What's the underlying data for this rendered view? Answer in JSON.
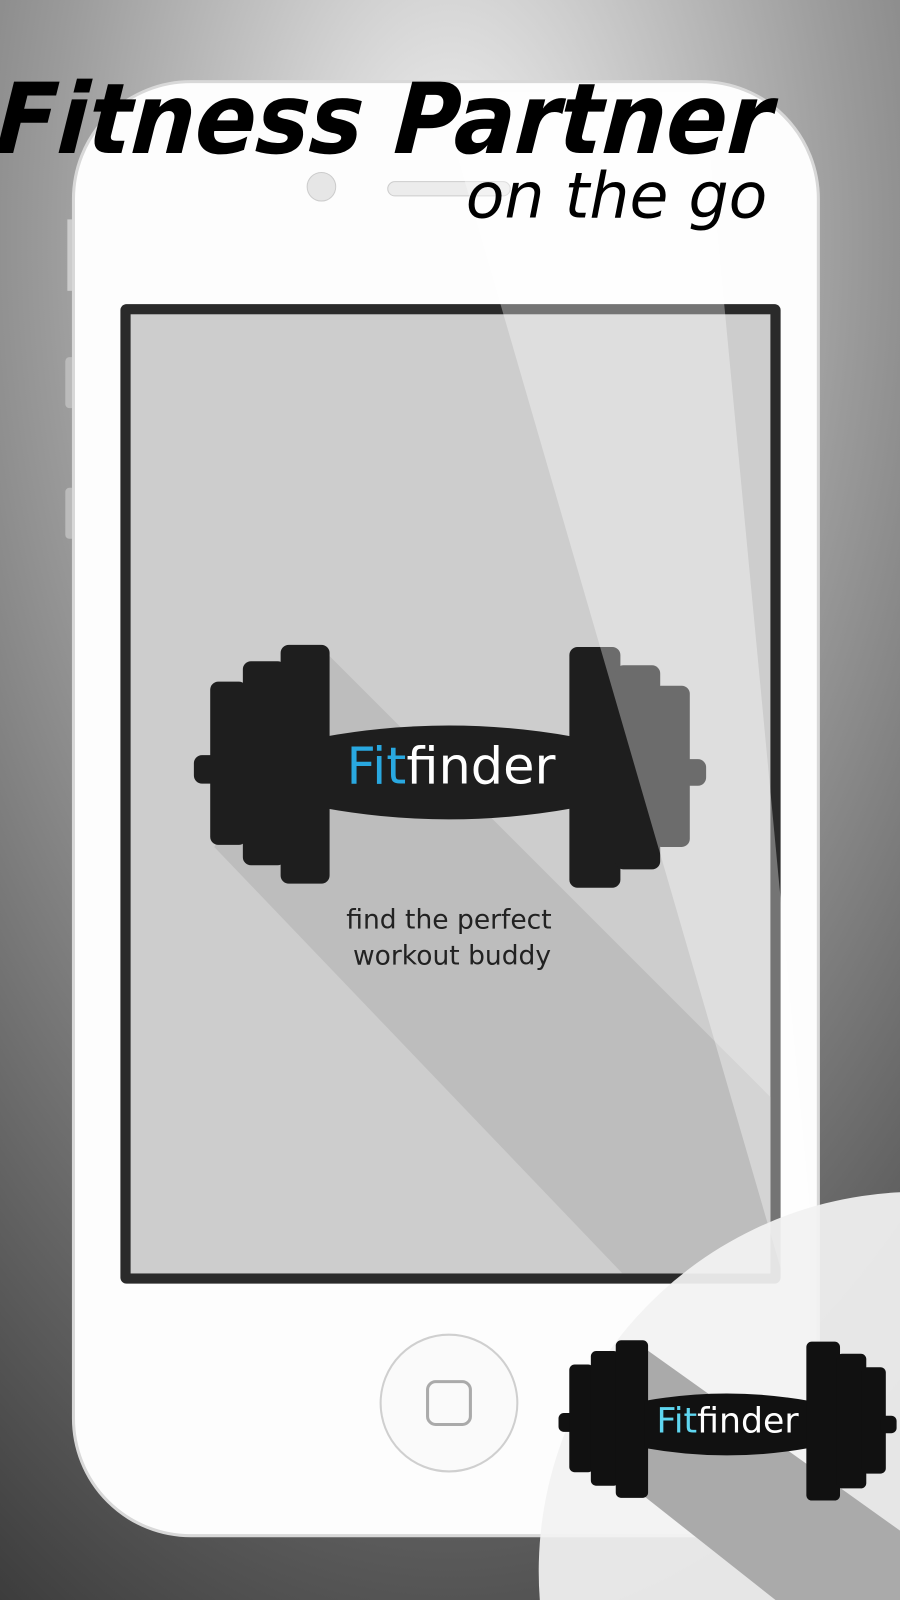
{
  "headline": {
    "title": "Fitness Partner",
    "subtitle": "on the go"
  },
  "app": {
    "name_accent": "Fit",
    "name_rest": "finder",
    "tagline_line1": "find the perfect",
    "tagline_line2": "workout buddy"
  },
  "badge": {
    "name_accent": "Fit",
    "name_rest": "finder"
  },
  "colors": {
    "accent": "#29a8e0",
    "badge_accent": "#5fd6f0",
    "logo": "#1e1e1e"
  }
}
